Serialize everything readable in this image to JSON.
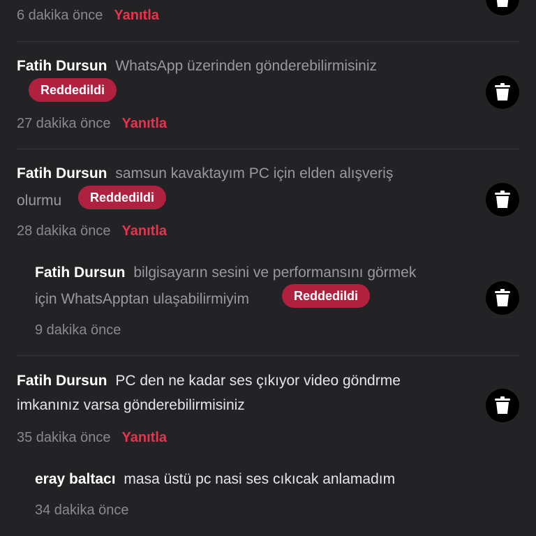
{
  "top": {
    "time": "6 dakika önce",
    "reply": "Yanıtla"
  },
  "c1": {
    "author": "Fatih Dursun",
    "text1": "WhatsApp üzerinden gönderebilirmisiniz",
    "badge": "Reddedildi",
    "time": "27 dakika önce",
    "reply": "Yanıtla"
  },
  "c2": {
    "author": "Fatih Dursun",
    "text1": "samsun kavaktayım PC için elden alışveriş",
    "text2": "olurmu",
    "badge": "Reddedildi",
    "time": "28 dakika önce",
    "reply": "Yanıtla"
  },
  "c3": {
    "author": "Fatih Dursun",
    "text1": "bilgisayarın sesini ve performansını görmek",
    "text2": "için WhatsApptan ulaşabilirmiyim",
    "badge": "Reddedildi",
    "time": "9 dakika önce"
  },
  "c4": {
    "author": "Fatih Dursun",
    "text1": "PC den ne kadar ses çıkıyor video göndrme",
    "text2": "imkanınız varsa gönderebilirmisiniz",
    "time": "35 dakika önce",
    "reply": "Yanıtla"
  },
  "c5": {
    "author": "eray baltacı",
    "text1": "masa üstü pc nasi ses cıkıcak anlamadım",
    "time": "34 dakika önce"
  },
  "icons": {
    "delete": "trash-icon"
  },
  "colors": {
    "background": "#232326",
    "badge": "#b0213f",
    "reply": "#e8334f"
  }
}
